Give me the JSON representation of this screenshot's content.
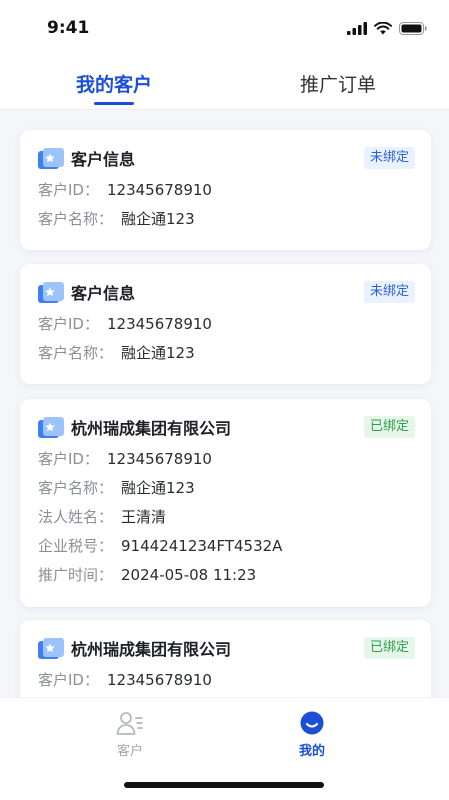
{
  "status_bar": {
    "time": "9:41"
  },
  "tabs": [
    {
      "label": "我的客户",
      "active": true
    },
    {
      "label": "推广订单",
      "active": false
    }
  ],
  "customers": [
    {
      "title": "客户信息",
      "status": "未绑定",
      "fields": [
        {
          "label": "客户ID：",
          "value": "12345678910"
        },
        {
          "label": "客户名称：",
          "value": "融企通123"
        }
      ]
    },
    {
      "title": "客户信息",
      "status": "未绑定",
      "fields": [
        {
          "label": "客户ID：",
          "value": "12345678910"
        },
        {
          "label": "客户名称：",
          "value": "融企通123"
        }
      ]
    },
    {
      "title": "杭州瑞成集团有限公司",
      "status": "已绑定",
      "fields": [
        {
          "label": "客户ID：",
          "value": "12345678910"
        },
        {
          "label": "客户名称：",
          "value": "融企通123"
        },
        {
          "label": "法人姓名：",
          "value": "王清清"
        },
        {
          "label": "企业税号：",
          "value": "9144241234FT4532A"
        },
        {
          "label": "推广时间：",
          "value": "2024-05-08 11:23"
        }
      ]
    },
    {
      "title": "杭州瑞成集团有限公司",
      "status": "已绑定",
      "fields": [
        {
          "label": "客户ID：",
          "value": "12345678910"
        }
      ]
    }
  ],
  "bottom_nav": [
    {
      "label": "客户",
      "icon": "customer-icon",
      "active": false
    },
    {
      "label": "我的",
      "icon": "smile-icon",
      "active": true
    }
  ],
  "colors": {
    "accent": "#1c4fd6",
    "unbound": "#2d62d8",
    "bound": "#2f9e4f"
  }
}
